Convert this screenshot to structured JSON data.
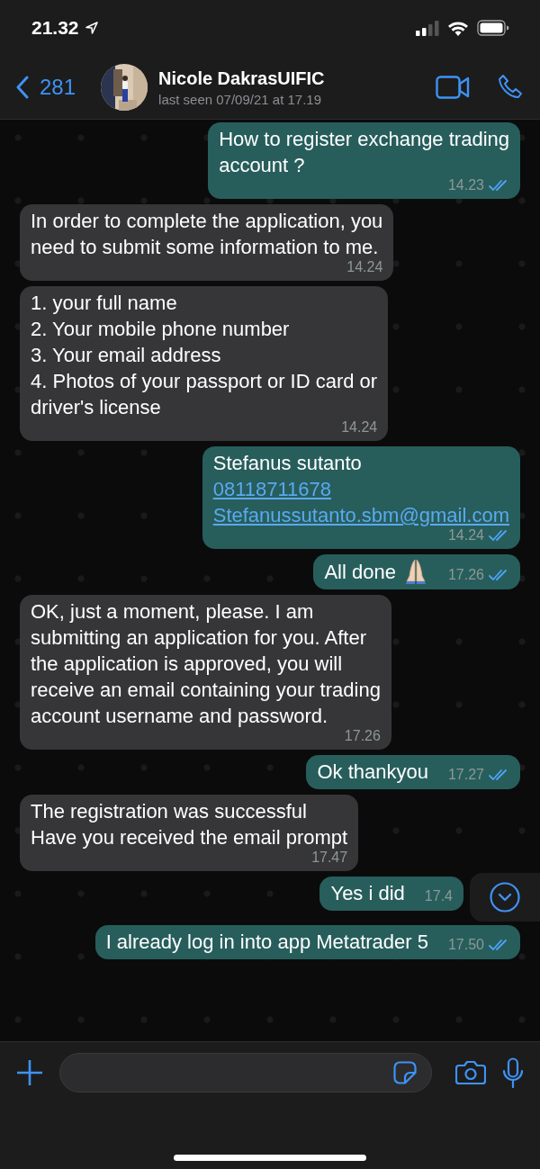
{
  "status_bar": {
    "time": "21.32"
  },
  "header": {
    "back_count": "281",
    "name": "Nicole DakrasUIFIC",
    "last_seen": "last seen 07/09/21 at 17.19"
  },
  "messages": [
    {
      "kind": "outgoing",
      "parts": [
        {
          "kind": "text",
          "text": "How to register exchange trading\naccount ?"
        }
      ],
      "time": "14.23",
      "read": true
    },
    {
      "kind": "incoming",
      "parts": [
        {
          "kind": "text",
          "text": "In order to complete the application, you\nneed to submit some information to me."
        }
      ],
      "time": "14.24"
    },
    {
      "kind": "incoming",
      "parts": [
        {
          "kind": "text",
          "text": "1. your full name\n2. Your mobile phone number\n3. Your email address\n4. Photos of your passport or ID card or\ndriver's license"
        }
      ],
      "time": "14.24"
    },
    {
      "kind": "outgoing",
      "parts": [
        {
          "kind": "text",
          "text": "Stefanus sutanto"
        },
        {
          "kind": "link",
          "text": "08118711678"
        },
        {
          "kind": "link",
          "text": "Stefanussutanto.sbm@gmail.com"
        }
      ],
      "time": "14.24",
      "read": true
    },
    {
      "kind": "outgoing",
      "parts": [
        {
          "kind": "text",
          "text": "All done"
        },
        {
          "kind": "emoji"
        }
      ],
      "time": "17.26",
      "read": true
    },
    {
      "kind": "incoming",
      "parts": [
        {
          "kind": "text",
          "text": "OK, just a moment, please. I am\nsubmitting an application for you. After\nthe application is approved, you will\nreceive an email containing your trading\naccount username and password."
        }
      ],
      "time": "17.26"
    },
    {
      "kind": "outgoing",
      "parts": [
        {
          "kind": "text",
          "text": "Ok thankyou"
        }
      ],
      "time": "17.27",
      "read": true
    },
    {
      "kind": "incoming",
      "parts": [
        {
          "kind": "text",
          "text": "The registration was successful\nHave you received the email prompt"
        }
      ],
      "time": "17.47"
    },
    {
      "kind": "outgoing",
      "parts": [
        {
          "kind": "text",
          "text": "Yes i did"
        }
      ],
      "time": "17.4",
      "read": false
    },
    {
      "kind": "outgoing",
      "parts": [
        {
          "kind": "text",
          "text": "I already log in into app Metatrader 5"
        }
      ],
      "time": "17.50",
      "read": true
    }
  ]
}
